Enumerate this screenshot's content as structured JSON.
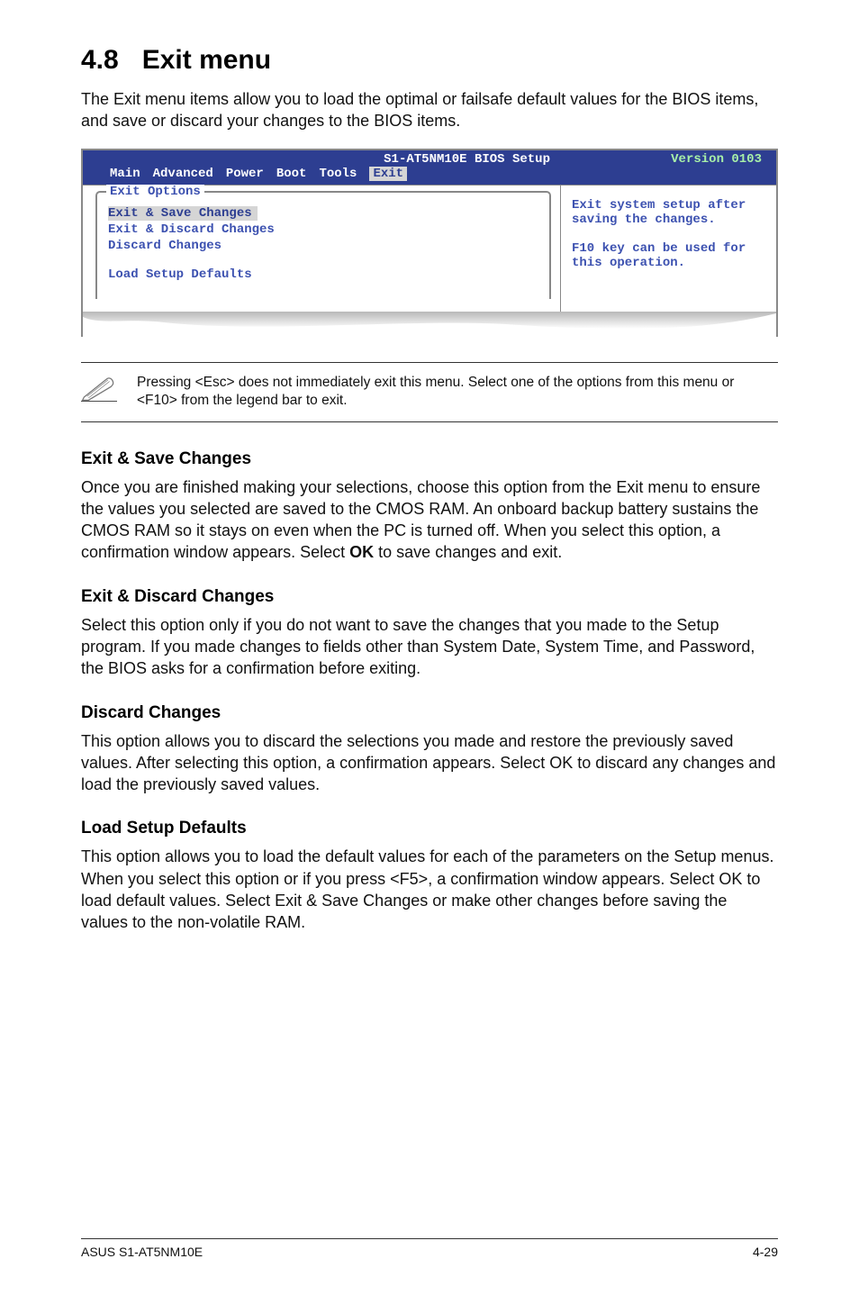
{
  "heading": {
    "num": "4.8",
    "title": "Exit menu"
  },
  "intro": "The Exit menu items allow you to load the optimal or failsafe default values for the BIOS items, and save or discard your changes to the BIOS items.",
  "bios": {
    "title": "S1-AT5NM10E BIOS Setup",
    "version": "Version 0103",
    "menu": {
      "main": "Main",
      "advanced": "Advanced",
      "power": "Power",
      "boot": "Boot",
      "tools": "Tools",
      "exit": "Exit"
    },
    "panel_title": "Exit Options",
    "items": {
      "save": "Exit & Save Changes",
      "discard_exit": "Exit & Discard Changes",
      "discard": "Discard Changes",
      "defaults": "Load Setup Defaults"
    },
    "help": "Exit system setup after saving the changes.\n\nF10 key can be used for this operation."
  },
  "note": "Pressing <Esc> does not immediately exit this menu. Select one of the options from this menu or <F10> from the legend bar to exit.",
  "sections": {
    "s1": {
      "title": "Exit & Save Changes",
      "body": "Once you are finished making your selections, choose this option from the Exit menu to ensure the values you selected are saved to the CMOS RAM. An onboard backup battery sustains the CMOS RAM so it stays on even when the PC is turned off. When you select this option, a confirmation window appears. Select OK to save changes and exit."
    },
    "s2": {
      "title": "Exit & Discard Changes",
      "body": "Select this option only if you do not want to save the changes that you  made to the Setup program. If you made changes to fields other than System Date, System Time, and Password, the BIOS asks for a confirmation before exiting."
    },
    "s3": {
      "title": "Discard Changes",
      "body": "This option allows you to discard the selections you made and restore the previously saved values. After selecting this option, a confirmation appears. Select OK to discard any changes and load the previously saved values."
    },
    "s4": {
      "title": "Load Setup Defaults",
      "body": "This option allows you to load the default values for each of the parameters on the Setup menus. When you select this option or if you press <F5>, a confirmation window appears. Select OK to load default values. Select Exit & Save Changes or make other changes before saving the values to the non-volatile RAM."
    }
  },
  "footer": {
    "left": "ASUS S1-AT5NM10E",
    "right": "4-29"
  }
}
